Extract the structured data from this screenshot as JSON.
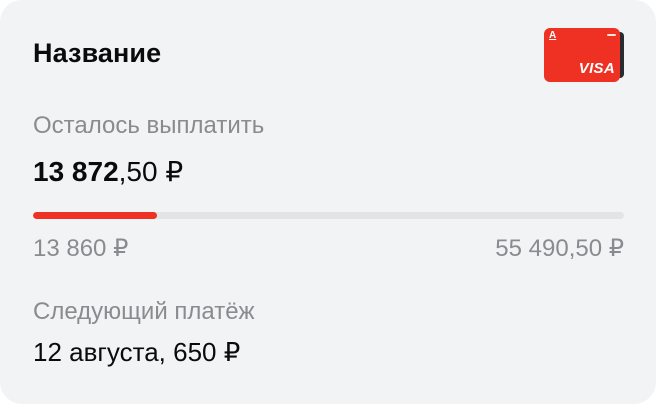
{
  "card": {
    "title": "Название",
    "bank_card": {
      "logo": "А",
      "network": "VISA",
      "color": "#ef3124"
    },
    "remaining": {
      "label": "Осталось выплатить",
      "amount_integer": "13 872",
      "amount_fraction": ",50 ₽"
    },
    "progress": {
      "paid": "13 860 ₽",
      "total": "55 490,50 ₽",
      "fraction": 0.21,
      "color": "#ef3124"
    },
    "next_payment": {
      "label": "Следующий платёж",
      "value": "12 августа, 650 ₽"
    }
  }
}
